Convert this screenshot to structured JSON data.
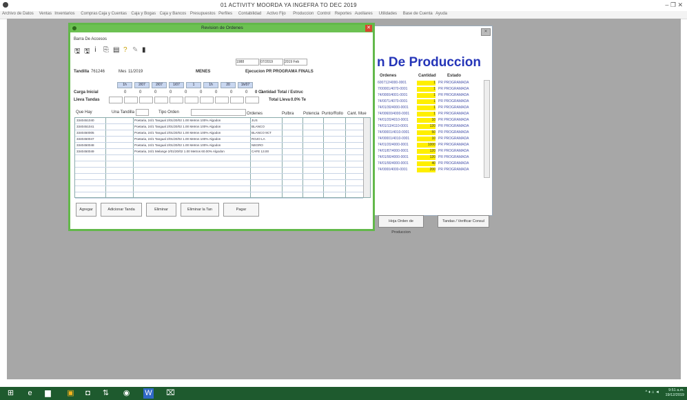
{
  "app": {
    "title": "01  ACTIVITY MOORDA  YA      INGEFRA              TO DEC 2019",
    "menu": [
      "Archivo de Datos",
      "Ventas",
      "Inventarios",
      "Compras",
      "Caja y Cuentas",
      "Caja y Bogas",
      "Caja y Bancos",
      "Presupuestos",
      "Perfiles",
      "Contabilidad",
      "Activo Fijo",
      "Produccion",
      "Control",
      "Reportes",
      "Auxiliares",
      "Utilidades",
      "Base de Cuenta",
      "Ayuda"
    ],
    "window_controls": "– ❐ ✕"
  },
  "bg_window": {
    "title": "n De Produccion",
    "columns": [
      "Ordenes",
      "Cantidad",
      "Estado"
    ],
    "rows": [
      {
        "orden": "600712/4000-0001",
        "cantidad": "1",
        "estado": "PR PROGRAMADA"
      },
      {
        "orden": "7/00001/4070-0001",
        "cantidad": "1",
        "estado": "PR PROGRAMADA"
      },
      {
        "orden": "74/0000/4001-0001",
        "cantidad": "1",
        "estado": "PR PROGRAMADA"
      },
      {
        "orden": "74/0071/4070-0001",
        "cantidad": "1",
        "estado": "PR PROGRAMADA"
      },
      {
        "orden": "74/01/30/4000-0001",
        "cantidad": "1",
        "estado": "PR PROGRAMADA"
      },
      {
        "orden": "74/00600/4000-0001",
        "cantidad": "1",
        "estado": "PR PROGRAMADA"
      },
      {
        "orden": "74/01/20/4010-0001",
        "cantidad": "10",
        "estado": "PR PROGRAMADA"
      },
      {
        "orden": "74/01/13/4110-0001",
        "cantidad": "120",
        "estado": "PR PROGRAMADA"
      },
      {
        "orden": "74/00001/4010-0001",
        "cantidad": "50",
        "estado": "PR PROGRAMADA"
      },
      {
        "orden": "74/00001/4010-0001",
        "cantidad": "10",
        "estado": "PR PROGRAMADA"
      },
      {
        "orden": "74/01/20/4000-0001",
        "cantidad": "1000",
        "estado": "PR PROGRAMADA"
      },
      {
        "orden": "74/01/87/4000-0001",
        "cantidad": "120",
        "estado": "PR PROGRAMADA"
      },
      {
        "orden": "74/01/90/4000-0001",
        "cantidad": "120",
        "estado": "PR PROGRAMADA"
      },
      {
        "orden": "74/01/90/4000-0001",
        "cantidad": "40",
        "estado": "PR PROGRAMADA"
      },
      {
        "orden": "74/0000/4000-0001",
        "cantidad": "200",
        "estado": "PR PROGRAMADA"
      }
    ],
    "btn_orden": "Hoja Orden de Produccion",
    "btn_tandas": "Tandas / Verificar Consul"
  },
  "dialog": {
    "title": "Revision de Ordenes",
    "subtitle": "Barra De Accesos",
    "toolbar_icons": [
      "save-icon",
      "save-all-icon",
      "info-icon",
      "copy-icon",
      "print-icon",
      "help-icon",
      "pen-icon",
      "exit-icon"
    ],
    "tanda_label": "Tandilla",
    "tanda_value": "761246",
    "mes_label": "Mes",
    "mes_value": "11/2019",
    "status": "MENES",
    "fields_top": [
      "1988",
      "07/2019",
      "2019 Feb"
    ],
    "ejecucion": "Ejecucion PR PROGRAMA FINALS",
    "week_boxes": [
      "1h",
      "2/07",
      "2/07",
      "1/07",
      "1",
      "1h",
      "20",
      "1h/07"
    ],
    "carga_label": "Carga Inicial",
    "carga_values": [
      "0",
      "0",
      "0",
      "0",
      "0",
      "0",
      "0",
      "0",
      "0",
      "0"
    ],
    "carga_total_label": "0  Cantidad Total / Estruc",
    "lleva_label": "Lleva Tandas",
    "total_label": "Total Lleva",
    "total_value": "0.0% Te",
    "filter_labels": [
      "Que Hay",
      "Una Tandilla",
      "Tipo Orden"
    ],
    "grid_headers": [
      "Ordenes",
      "Pulbra",
      "Potencia",
      "Punto/Rollo",
      "Cant. Mue"
    ],
    "grid_rows": [
      {
        "code": "3340451040",
        "desc": "Poetaria, 24/1 Tangual 2/01/20/02 1.00 Metros 100% Algodon",
        "extra": "JUS"
      },
      {
        "code": "3340451041",
        "desc": "Poetaria, 24/1 Tangual 2/01/20/02 1.00 Metros 100% Algodon",
        "extra": "BLANCO"
      },
      {
        "code": "3340450005",
        "desc": "Poetaria, 24/1 Tangual 2/01/20/02 1.00 Metros 100% Algodon",
        "extra": "BLANCO 9CT"
      },
      {
        "code": "3340450047",
        "desc": "Poetaria, 24/1 Tangual 2/01/20/02 1.00 Metros 100% Algodon",
        "extra": "ROJO LA"
      },
      {
        "code": "3340450048",
        "desc": "Poetaria, 24/1 Tangual 2/01/20/02 1.00 Metros 100% Algodon",
        "extra": "NEGRO"
      },
      {
        "code": "3340450049",
        "desc": "Poetaria, 24/1 Melange 2/01/20/02 1.00 Metros 60.00% Algodon",
        "extra": "CAFE 13.00"
      }
    ],
    "buttons": [
      "Agregar",
      "Adicionar Tanda",
      "Eliminar",
      "Eliminar la Tan",
      "Pagar"
    ]
  },
  "taskbar": {
    "icons": [
      "windows-icon",
      "edge-icon",
      "explorer-icon",
      "app-icon",
      "store-icon",
      "settings-icon",
      "chrome-icon",
      "word-icon",
      "terminal-icon"
    ],
    "tray": "^ ♦ ⌂ ◄",
    "time": "9:51 a.m.",
    "date": "19/12/2019"
  },
  "colors": {
    "accent": "#62b84a",
    "taskbar": "#1e5a2e",
    "title_blue": "#2535b8",
    "highlight": "#ffef00"
  }
}
